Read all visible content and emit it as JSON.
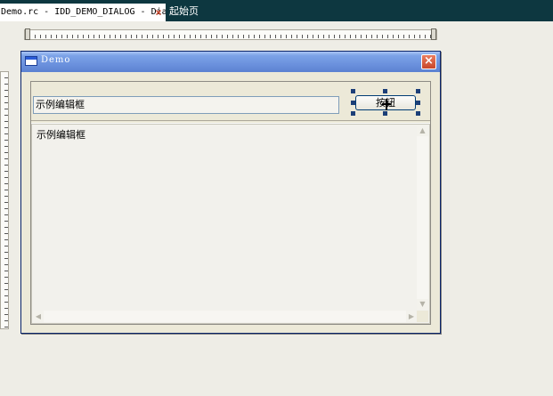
{
  "tabs": {
    "active_label": "Demo.rc - IDD_DEMO_DIALOG - Dialog",
    "close_symbol": "×",
    "start_page_label": "起始页"
  },
  "dialog": {
    "title": "Demo",
    "close_symbol": "×",
    "edit_value": "示例编辑框",
    "button_label": "按钮",
    "textarea_text": "示例编辑框"
  },
  "colors": {
    "tab_bar": "#0d3740",
    "titlebar_accent": "#6c92de",
    "selection_handle": "#1c3f78"
  },
  "icons": {
    "tab_close": "close-icon",
    "dialog_close": "close-icon",
    "window_icon": "window-icon",
    "move_cursor": "move-cursor-icon"
  }
}
